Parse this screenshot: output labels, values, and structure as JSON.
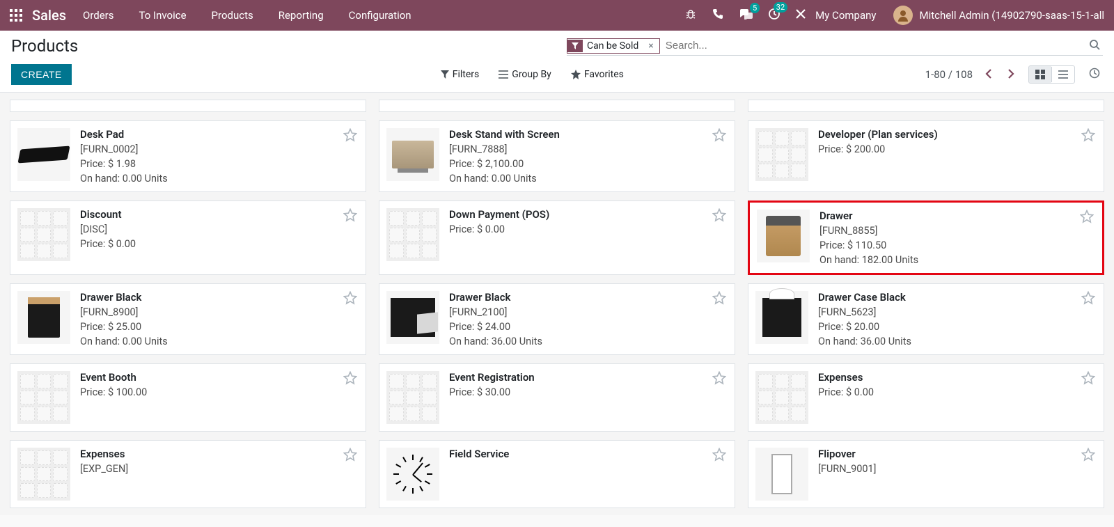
{
  "nav": {
    "brand": "Sales",
    "menu": [
      "Orders",
      "To Invoice",
      "Products",
      "Reporting",
      "Configuration"
    ],
    "badges": {
      "chat": "5",
      "activity": "32"
    },
    "company": "My Company",
    "user": "Mitchell Admin (14902790-saas-15-1-all"
  },
  "cp": {
    "title": "Products",
    "create": "CREATE",
    "filter_facet": "Can be Sold",
    "search_placeholder": "Search...",
    "filters": "Filters",
    "groupby": "Group By",
    "favorites": "Favorites",
    "pager": "1-80 / 108"
  },
  "labels": {
    "price_prefix": "Price: ",
    "onhand_prefix": "On hand: "
  },
  "products": [
    {
      "name": "Desk Pad",
      "code": "[FURN_0002]",
      "price": "$ 1.98",
      "onhand": "0.00 Units",
      "img": "deskpad"
    },
    {
      "name": "Desk Stand with Screen",
      "code": "[FURN_7888]",
      "price": "$ 2,100.00",
      "onhand": "0.00 Units",
      "img": "deskstand"
    },
    {
      "name": "Developer (Plan services)",
      "code": "",
      "price": "$ 200.00",
      "onhand": "",
      "img": "placeholder"
    },
    {
      "name": "Discount",
      "code": "[DISC]",
      "price": "$ 0.00",
      "onhand": "",
      "img": "placeholder"
    },
    {
      "name": "Down Payment (POS)",
      "code": "",
      "price": "$ 0.00",
      "onhand": "",
      "img": "placeholder"
    },
    {
      "name": "Drawer",
      "code": "[FURN_8855]",
      "price": "$ 110.50",
      "onhand": "182.00 Units",
      "img": "drawer-wood",
      "highlight": true
    },
    {
      "name": "Drawer Black",
      "code": "[FURN_8900]",
      "price": "$ 25.00",
      "onhand": "0.00 Units",
      "img": "drawer-blk1"
    },
    {
      "name": "Drawer Black",
      "code": "[FURN_2100]",
      "price": "$ 24.00",
      "onhand": "36.00 Units",
      "img": "drawer-blk2"
    },
    {
      "name": "Drawer Case Black",
      "code": "[FURN_5623]",
      "price": "$ 20.00",
      "onhand": "36.00 Units",
      "img": "drawer-case"
    },
    {
      "name": "Event Booth",
      "code": "",
      "price": "$ 100.00",
      "onhand": "",
      "img": "placeholder"
    },
    {
      "name": "Event Registration",
      "code": "",
      "price": "$ 30.00",
      "onhand": "",
      "img": "placeholder"
    },
    {
      "name": "Expenses",
      "code": "",
      "price": "$ 0.00",
      "onhand": "",
      "img": "placeholder"
    },
    {
      "name": "Expenses",
      "code": "[EXP_GEN]",
      "price": "",
      "onhand": "",
      "img": "placeholder"
    },
    {
      "name": "Field Service",
      "code": "",
      "price": "",
      "onhand": "",
      "img": "clock"
    },
    {
      "name": "Flipover",
      "code": "[FURN_9001]",
      "price": "",
      "onhand": "",
      "img": "flipover"
    }
  ]
}
